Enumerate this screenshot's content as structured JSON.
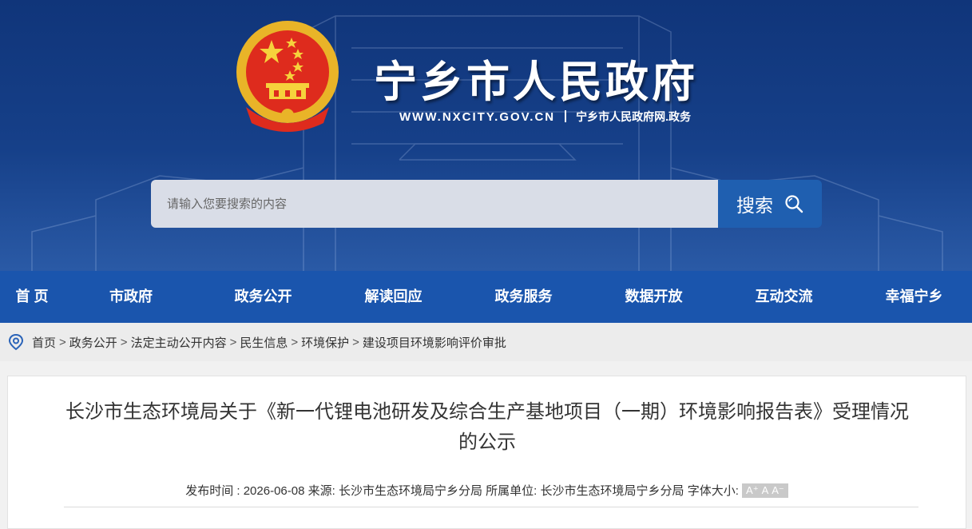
{
  "site": {
    "title": "宁乡市人民政府",
    "url": "WWW.NXCITY.GOV.CN",
    "subtitle": "宁乡市人民政府网.政务",
    "colors": {
      "header_bg": "#164089",
      "nav_bg": "#1a55ad",
      "search_btn": "#1f5fb0"
    }
  },
  "search": {
    "placeholder": "请输入您要搜索的内容",
    "button_label": "搜索",
    "icon": "search-icon"
  },
  "nav": {
    "items": [
      "首 页",
      "市政府",
      "政务公开",
      "解读回应",
      "政务服务",
      "数据开放",
      "互动交流",
      "幸福宁乡"
    ]
  },
  "breadcrumb": {
    "icon": "location-pin-icon",
    "items": [
      "首页",
      "政务公开",
      "法定主动公开内容",
      "民生信息",
      "环境保护",
      "建设项目环境影响评价审批"
    ]
  },
  "article": {
    "title": "长沙市生态环境局关于《新一代锂电池研发及综合生产基地项目（一期）环境影响报告表》受理情况的公示",
    "publish_label": "发布时间 :",
    "publish_date": "2026-06-08",
    "source_label": "来源:",
    "source": "长沙市生态环境局宁乡分局",
    "unit_label": "所属单位:",
    "unit": "长沙市生态环境局宁乡分局",
    "font_size_label": "字体大小:",
    "font_sizes": [
      "A⁺",
      "A",
      "A⁻"
    ]
  }
}
